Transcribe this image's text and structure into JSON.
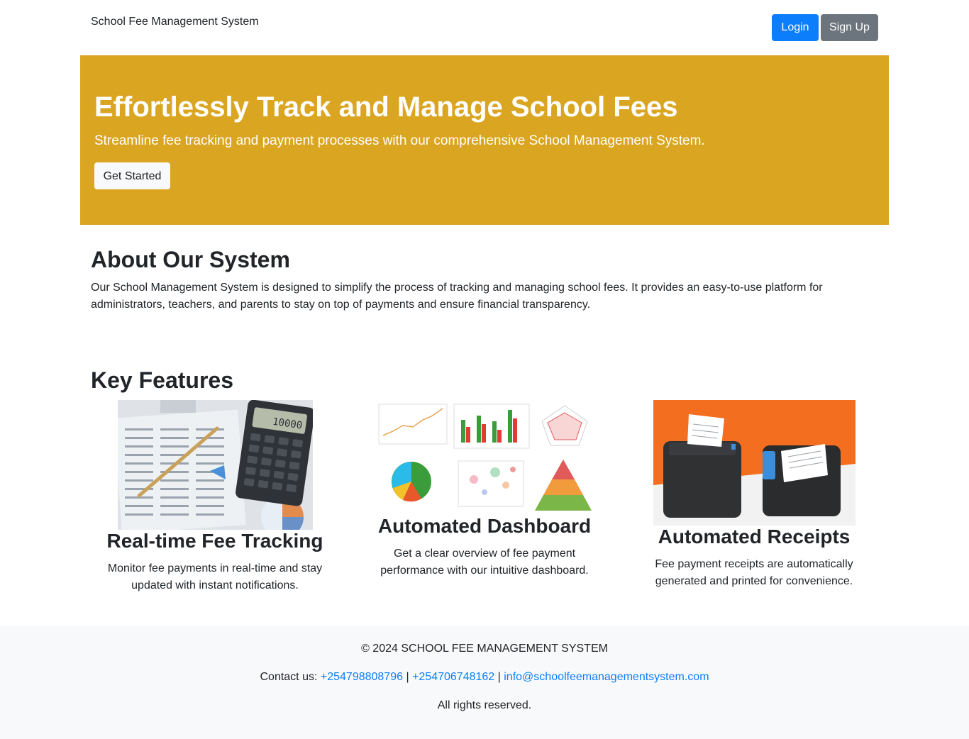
{
  "navbar": {
    "brand": "School Fee Management System",
    "login_label": "Login",
    "signup_label": "Sign Up"
  },
  "hero": {
    "title": "Effortlessly Track and Manage School Fees",
    "subtitle": "Streamline fee tracking and payment processes with our comprehensive School Management System.",
    "cta_label": "Get Started",
    "background_color": "#daa520"
  },
  "about": {
    "title": "About Our System",
    "text": "Our School Management System is designed to simplify the process of tracking and managing school fees. It provides an easy-to-use platform for administrators, teachers, and parents to stay on top of payments and ensure financial transparency."
  },
  "features": {
    "title": "Key Features",
    "items": [
      {
        "title": "Real-time Fee Tracking",
        "text": "Monitor fee payments in real-time and stay updated with instant notifications.",
        "image_icon": "calculator-image"
      },
      {
        "title": "Automated Dashboard",
        "text": "Get a clear overview of fee payment performance with our intuitive dashboard.",
        "image_icon": "dashboard-charts-image"
      },
      {
        "title": "Automated Receipts",
        "text": "Fee payment receipts are automatically generated and printed for convenience.",
        "image_icon": "receipt-printer-image"
      }
    ]
  },
  "footer": {
    "copyright": "© 2024 SCHOOL FEE MANAGEMENT SYSTEM",
    "contact_prefix": "Contact us:",
    "phone1": "+254798808796",
    "separator": "|",
    "phone2": "+254706748162",
    "email": "info@schoolfeemanagementsystem.com",
    "rights": "All rights reserved."
  },
  "colors": {
    "primary": "#0d7efb",
    "secondary": "#6c757d",
    "hero": "#daa520",
    "footer_bg": "#f8f9fa"
  }
}
